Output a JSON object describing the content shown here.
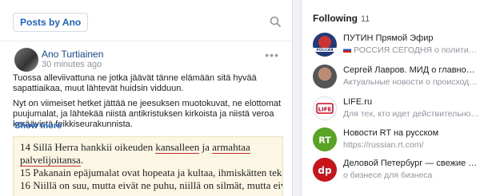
{
  "feed": {
    "posts_by_label": "Posts by Ano",
    "post": {
      "author": "Ano Turtiainen",
      "time": "30 minutes ago",
      "paragraph1": "Tuossa alleviivattuna ne jotka jäävät tänne elämään sitä hyvää sapattiaikaa, muut lähtevät huidsin vidduun.",
      "paragraph2": "Nyt on viimeiset hetket jättää ne jeesuksen muotokuvat, ne elottomat puujumalat, ja lähtekää niistä antikristuksen kirkoista ja niistä veroa keräävistä feikkiseurakunnista.",
      "show_more": "Show more",
      "scripture": {
        "v14_pre": "14 Sillä Herra hankkii oikeuden ",
        "v14_u1": "kansalleen",
        "v14_mid": " ja ",
        "v14_u2": "armahtaa",
        "v14_u3": "palvelijoitansa",
        "v14_end": ".",
        "v15": "15 Pakanain epäjumalat ovat hopeata ja kultaa, ihmiskätten tekoa.",
        "v16": "16 Niillä on suu, mutta eivät ne puhu, niillä on silmät, mutta eivät"
      }
    }
  },
  "following": {
    "title": "Following",
    "count": "11",
    "items": [
      {
        "name": "ПУТИН Прямой Эфир",
        "sub": "РОССИЯ СЕГОДНЯ о политическ...",
        "has_flag": true
      },
      {
        "name": "Сергей Лавров. МИД о главном / Ар...",
        "sub": "Актуальные новости о происходяще..."
      },
      {
        "name": "LIFE.ru",
        "sub": "Для тех, кто идет действительно осче..."
      },
      {
        "name": "Новости RT на русском",
        "sub": "https://russian.rt.com/"
      },
      {
        "name": "Деловой Петербург — свежие новос...",
        "sub": "о бизнесе для бизнеса"
      }
    ],
    "avatar_labels": {
      "putin": "РОССИЯ",
      "life": "LIFE",
      "rt": "RT",
      "dp": "dp"
    }
  }
}
